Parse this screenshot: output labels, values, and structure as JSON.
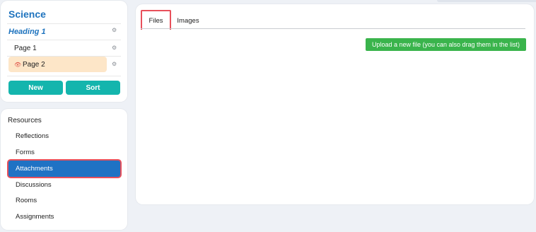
{
  "nav": {
    "title": "Science",
    "heading": "Heading 1",
    "pages": [
      "Page 1",
      "Page 2"
    ],
    "active_page": "Page 2",
    "buttons": {
      "new": "New",
      "sort": "Sort"
    }
  },
  "resources": {
    "title": "Resources",
    "items": [
      "Reflections",
      "Forms",
      "Attachments",
      "Discussions",
      "Rooms",
      "Assignments"
    ],
    "active_item": "Attachments"
  },
  "main": {
    "tabs": [
      "Files",
      "Images"
    ],
    "active_tab": "Files",
    "upload_label": "Upload a new file (you can also drag them in the list)"
  },
  "colors": {
    "brand_blue": "#1e73be",
    "teal": "#14b5ad",
    "green": "#3ab44c",
    "highlight_red": "#e8505b",
    "active_page_bg": "#fde6c8"
  },
  "icons": [
    "gear-icon",
    "eye-icon"
  ]
}
